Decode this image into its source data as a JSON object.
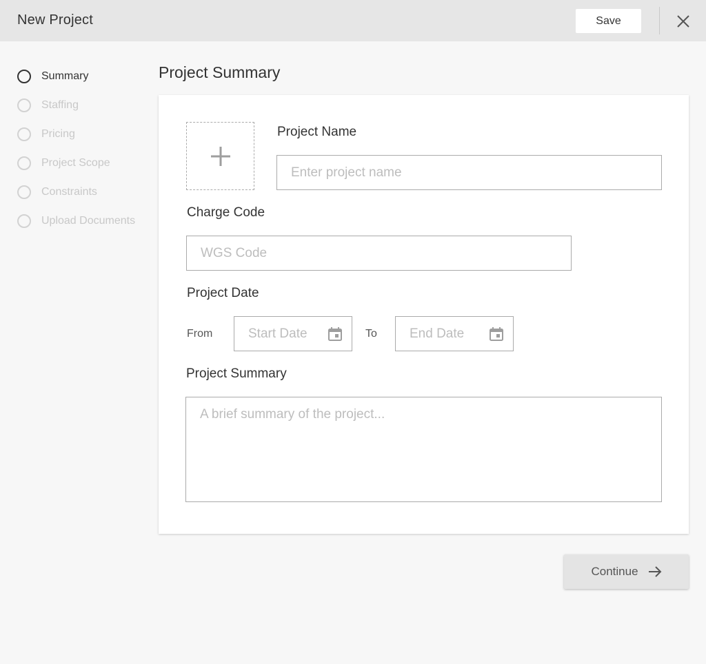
{
  "header": {
    "title": "New Project",
    "save_label": "Save",
    "close_icon": "close-icon"
  },
  "steps": [
    {
      "label": "Summary",
      "active": true
    },
    {
      "label": "Staffing",
      "active": false
    },
    {
      "label": "Pricing",
      "active": false
    },
    {
      "label": "Project Scope",
      "active": false
    },
    {
      "label": "Constraints",
      "active": false
    },
    {
      "label": "Upload Documents",
      "active": false
    }
  ],
  "main": {
    "section_title": "Project Summary",
    "upload_icon": "plus-icon",
    "project_name": {
      "label": "Project Name",
      "placeholder": "Enter project name",
      "value": ""
    },
    "charge_code": {
      "label": "Charge Code",
      "placeholder": "WGS Code",
      "value": ""
    },
    "project_date": {
      "label": "Project Date",
      "from_label": "From",
      "to_label": "To",
      "start_placeholder": "Start Date",
      "end_placeholder": "End Date",
      "calendar_icon": "calendar-icon"
    },
    "project_summary": {
      "label": "Project Summary",
      "placeholder": "A brief summary of the project..."
    }
  },
  "footer": {
    "continue_label": "Continue",
    "continue_icon": "arrow-right-icon"
  },
  "colors": {
    "header_bg": "#e6e6e6",
    "page_bg": "#f7f7f7",
    "card_bg": "#ffffff",
    "text": "#333333",
    "inactive": "#c8c8c8",
    "border": "#aaaaaa"
  }
}
